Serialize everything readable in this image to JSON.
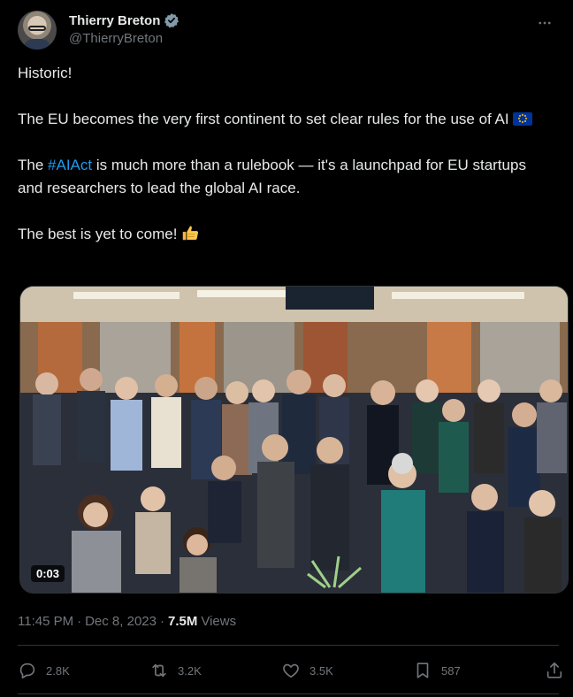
{
  "author": {
    "display_name": "Thierry Breton",
    "handle": "@ThierryBreton",
    "verified": true
  },
  "body": {
    "p1": "Historic!",
    "p2": "The EU becomes the very first continent to set clear rules for the use of AI",
    "p3_pre": "The ",
    "p3_hashtag": "#AIAct",
    "p3_post": " is much more than a rulebook — it's a launchpad for EU startups and researchers to lead the global AI race.",
    "p4": "The best is yet to come!"
  },
  "media": {
    "timecode": "0:03"
  },
  "meta": {
    "time": "11:45 PM",
    "dot1": "·",
    "date": "Dec 8, 2023",
    "dot2": "·",
    "views_count": "7.5M",
    "views_label": "Views"
  },
  "actions": {
    "reply_count": "2.8K",
    "repost_count": "3.2K",
    "like_count": "3.5K",
    "bookmark_count": "587"
  },
  "colors": {
    "background": "#000000",
    "text": "#e7e9ea",
    "muted": "#71767b",
    "accent": "#1d9bf0",
    "border": "#2f3336"
  }
}
